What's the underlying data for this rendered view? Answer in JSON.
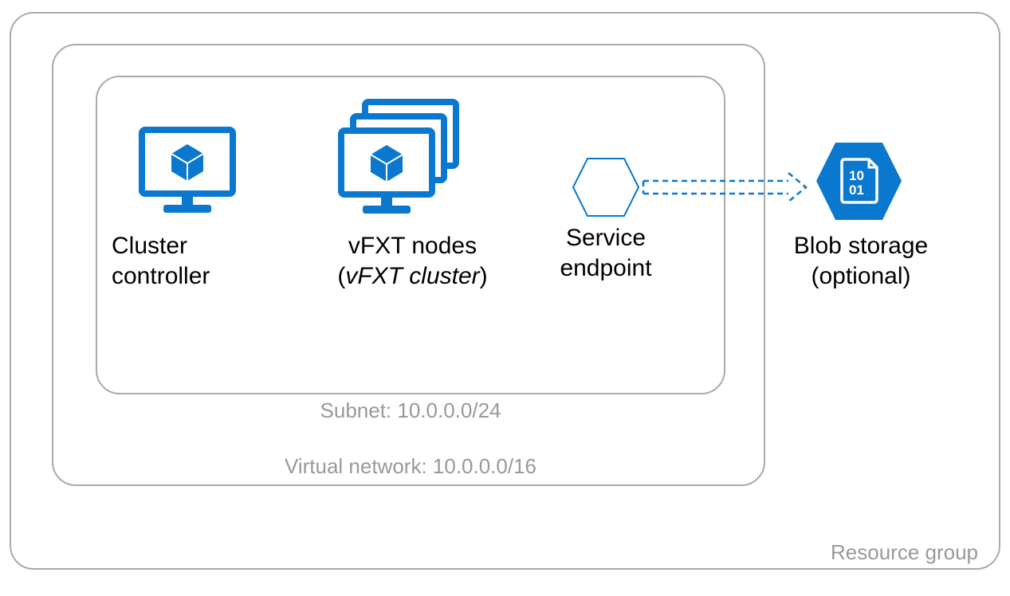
{
  "colors": {
    "azure_blue": "#0B78D0",
    "box_border": "#aaaaaa",
    "box_label": "#999999"
  },
  "boxes": {
    "resource_group": {
      "label": "Resource group"
    },
    "virtual_network": {
      "label": "Virtual network: 10.0.0.0/16"
    },
    "subnet": {
      "label": "Subnet: 10.0.0.0/24"
    }
  },
  "items": {
    "cluster_controller": {
      "label_line1": "Cluster",
      "label_line2": "controller"
    },
    "vfxt_nodes": {
      "label_line1": "vFXT nodes",
      "label_line2_prefix": "(",
      "label_line2_italic": "vFXT cluster",
      "label_line2_suffix": ")"
    },
    "service_endpoint": {
      "label_line1": "Service",
      "label_line2": "endpoint"
    },
    "blob_storage": {
      "label_line1": "Blob storage",
      "label_line2": "(optional)"
    }
  }
}
